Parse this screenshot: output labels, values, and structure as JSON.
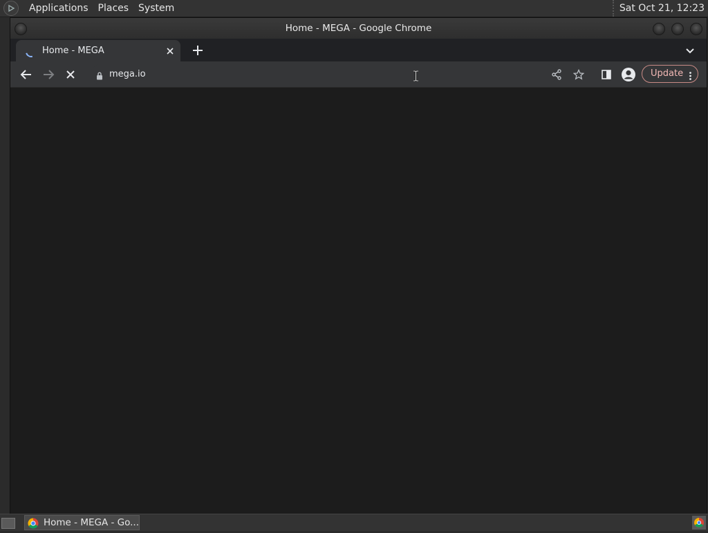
{
  "top_panel": {
    "menus": [
      "Applications",
      "Places",
      "System"
    ],
    "clock": "Sat Oct 21, 12:23"
  },
  "window": {
    "title": "Home - MEGA - Google Chrome"
  },
  "tabs": [
    {
      "title": "Home - MEGA",
      "active": true,
      "loading": true
    }
  ],
  "toolbar": {
    "url": "mega.io",
    "update_label": "Update"
  },
  "taskbar": {
    "item_label": "Home - MEGA - Go..."
  },
  "colors": {
    "accent": "#8ab4f8",
    "update_border": "#c98b86",
    "update_text": "#f2b8b5"
  },
  "icons": [
    "menu-logo-icon",
    "back-icon",
    "forward-icon",
    "stop-icon",
    "lock-icon",
    "share-icon",
    "bookmark-star-icon",
    "side-panel-icon",
    "profile-icon",
    "more-menu-icon",
    "tab-search-icon",
    "new-tab-icon",
    "close-tab-icon",
    "chrome-icon",
    "show-desktop-icon"
  ]
}
